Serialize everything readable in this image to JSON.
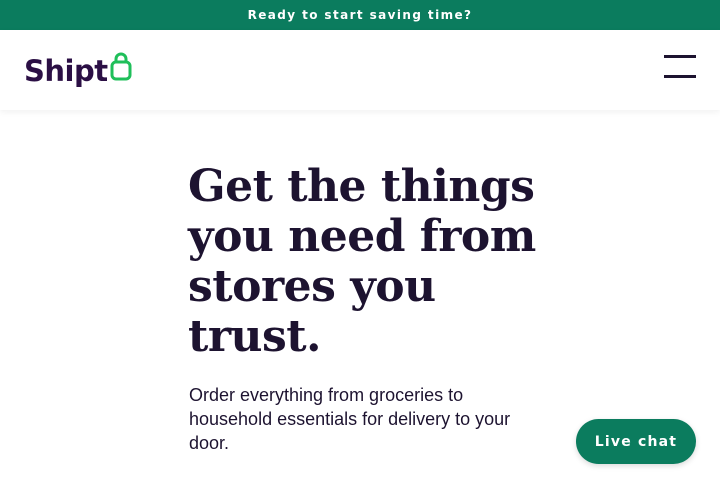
{
  "promo": {
    "text": "Ready to start saving time?"
  },
  "header": {
    "logo_text": "Shipt",
    "logo_icon": "shopping-bag-icon",
    "menu_icon": "hamburger-menu-icon"
  },
  "hero": {
    "heading": "Get the things you need from stores you trust.",
    "subheading": "Order everything from groceries to household essentials for delivery to your door."
  },
  "chat": {
    "label": "Live chat"
  },
  "colors": {
    "brand_green": "#0b7c5e",
    "logo_green": "#1fbf5a",
    "brand_purple": "#2b0f45",
    "text_dark": "#1d1330"
  }
}
